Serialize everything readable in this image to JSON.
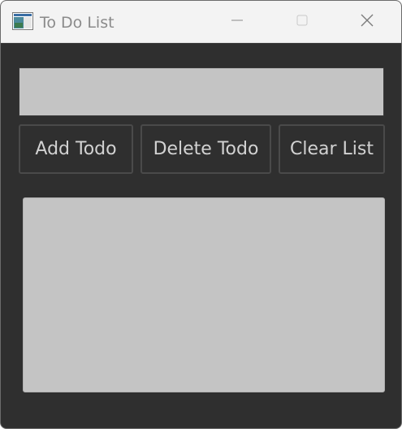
{
  "window": {
    "title": "To Do List",
    "icon": "app-window-icon",
    "controls": {
      "minimize_icon": "minimize-icon",
      "maximize_icon": "maximize-icon",
      "close_icon": "close-icon"
    }
  },
  "form": {
    "input_value": "",
    "input_placeholder": ""
  },
  "buttons": {
    "add_label": "Add Todo",
    "delete_label": "Delete Todo",
    "clear_label": "Clear List"
  },
  "list": {
    "items": []
  },
  "colors": {
    "background": "#2f2f2f",
    "titlebar": "#f3f3f3",
    "field": "#c4c4c4",
    "button_text": "#d2d2d2",
    "button_border": "#4a4a4a"
  }
}
